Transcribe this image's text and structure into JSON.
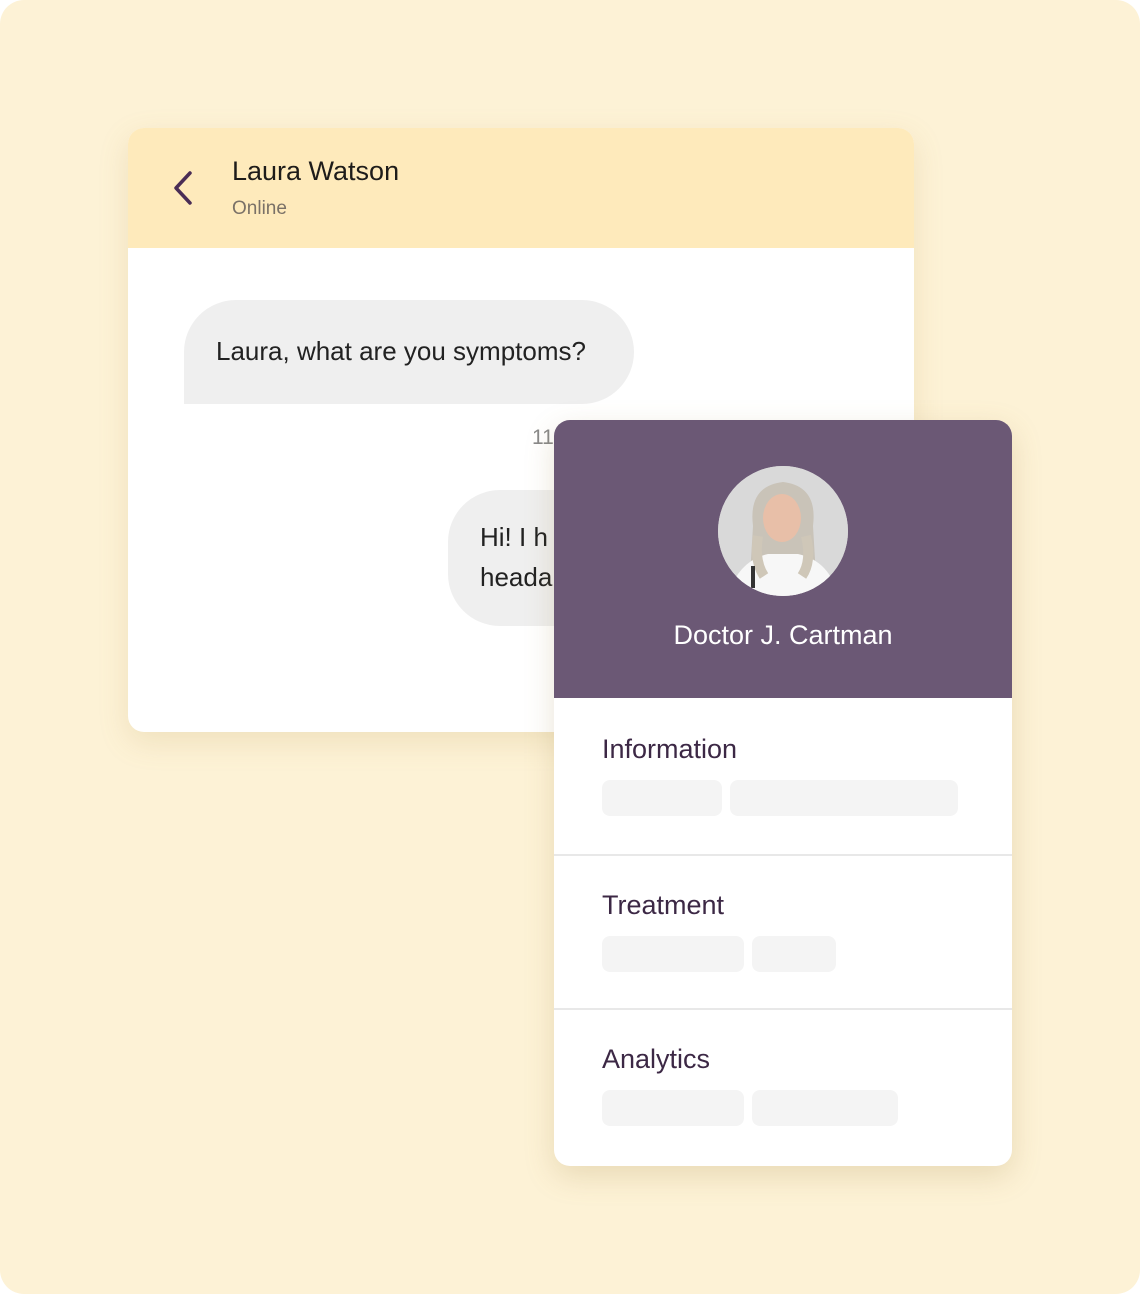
{
  "chat": {
    "contact_name": "Laura Watson",
    "contact_status": "Online",
    "back_icon": "chevron-left-icon",
    "messages": [
      {
        "direction": "incoming",
        "text": "Laura, what are you symptoms?"
      },
      {
        "direction": "timestamp",
        "text": "11"
      },
      {
        "direction": "outgoing",
        "lines": [
          "Hi! I  h",
          "heada"
        ]
      }
    ]
  },
  "doctor_card": {
    "name": "Doctor J. Cartman",
    "avatar": "doctor-portrait",
    "header_color": "#6b5875",
    "sections": [
      {
        "title": "Information"
      },
      {
        "title": "Treatment"
      },
      {
        "title": "Analytics"
      }
    ]
  },
  "colors": {
    "background": "#fdf2d6",
    "chat_header": "#feeabb",
    "accent": "#4a2d55"
  }
}
